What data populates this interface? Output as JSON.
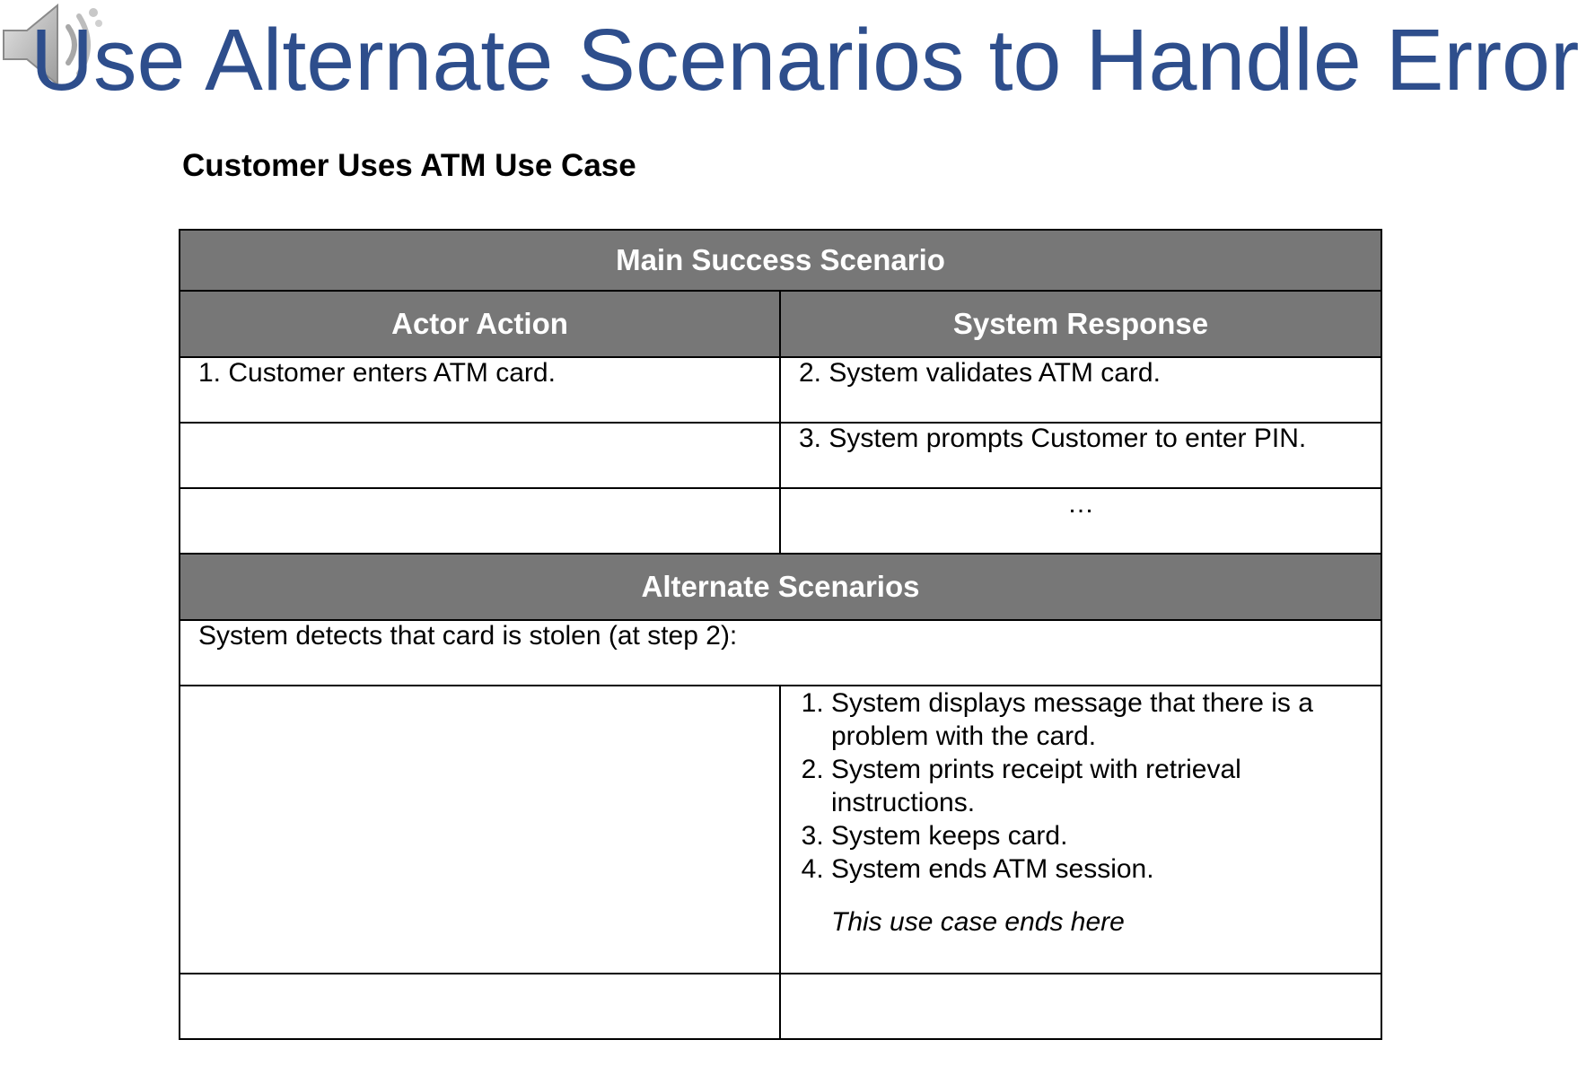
{
  "slide": {
    "title": "Use Alternate Scenarios to Handle Errors",
    "subtitle": "Customer Uses ATM Use Case"
  },
  "table": {
    "main_header": "Main Success Scenario",
    "col_actor": "Actor Action",
    "col_system": "System Response",
    "main_rows": [
      {
        "actor": "1. Customer enters ATM card.",
        "system": "2. System validates ATM card."
      },
      {
        "actor": "",
        "system": "3. System prompts Customer to enter PIN."
      },
      {
        "actor": "",
        "system": "…"
      }
    ],
    "alt_header": "Alternate Scenarios",
    "alt_condition": "System detects that card is stolen (at step 2):",
    "alt_steps": [
      "System displays message that there is a problem with the card.",
      "System prints receipt with retrieval instructions.",
      "System keeps card.",
      "System ends ATM session."
    ],
    "alt_end_note": "This use case ends here"
  },
  "icons": {
    "speaker": "speaker-icon"
  },
  "colors": {
    "title": "#2e4e8c",
    "header_bg": "#777777",
    "header_text": "#ffffff"
  }
}
